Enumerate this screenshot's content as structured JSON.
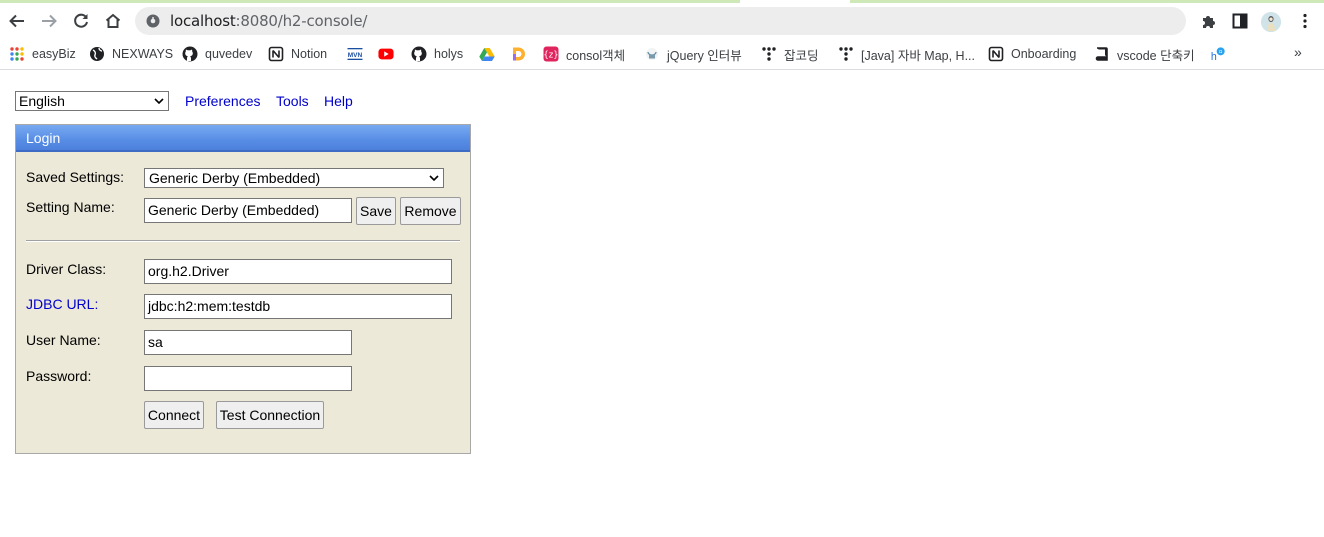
{
  "browser": {
    "url_host": "localhost",
    "url_rest": ":8080/h2-console/",
    "bookmarks": [
      {
        "label": "easyBiz",
        "icon": "apps-grid-icon"
      },
      {
        "label": "NEXWAYS",
        "icon": "globe-icon"
      },
      {
        "label": "quvedev",
        "icon": "github-icon"
      },
      {
        "label": "Notion",
        "icon": "notion-icon"
      },
      {
        "label": "",
        "icon": "mvn-icon"
      },
      {
        "label": "",
        "icon": "youtube-icon"
      },
      {
        "label": "holys",
        "icon": "github-icon"
      },
      {
        "label": "",
        "icon": "google-drive-icon"
      },
      {
        "label": "",
        "icon": "d-app-icon"
      },
      {
        "label": "consol객체",
        "icon": "zdoc-icon"
      },
      {
        "label": "jQuery 인터뷰",
        "icon": "jquery-icon"
      },
      {
        "label": "잡코딩",
        "icon": "tistory-icon"
      },
      {
        "label": "[Java] 자바 Map, H...",
        "icon": "tistory-icon"
      },
      {
        "label": "Onboarding",
        "icon": "notion-icon"
      },
      {
        "label": "vscode 단축키",
        "icon": "book-icon"
      },
      {
        "label": "",
        "icon": "hosting-icon"
      }
    ],
    "more": "»"
  },
  "topbar": {
    "language": "English",
    "links": [
      "Preferences",
      "Tools",
      "Help"
    ]
  },
  "login": {
    "title": "Login",
    "saved_settings_label": "Saved Settings:",
    "saved_settings_value": "Generic Derby (Embedded)",
    "setting_name_label": "Setting Name:",
    "setting_name_value": "Generic Derby (Embedded)",
    "save_label": "Save",
    "remove_label": "Remove",
    "driver_class_label": "Driver Class:",
    "driver_class_value": "org.h2.Driver",
    "jdbc_url_label": "JDBC URL:",
    "jdbc_url_value": "jdbc:h2:mem:testdb",
    "user_name_label": "User Name:",
    "user_name_value": "sa",
    "password_label": "Password:",
    "password_value": "",
    "connect_label": "Connect",
    "test_connection_label": "Test Connection"
  },
  "colors": {
    "link": "#0000cc",
    "panel_bg": "#ece9d8",
    "header_blue": "#5a8fe6"
  }
}
